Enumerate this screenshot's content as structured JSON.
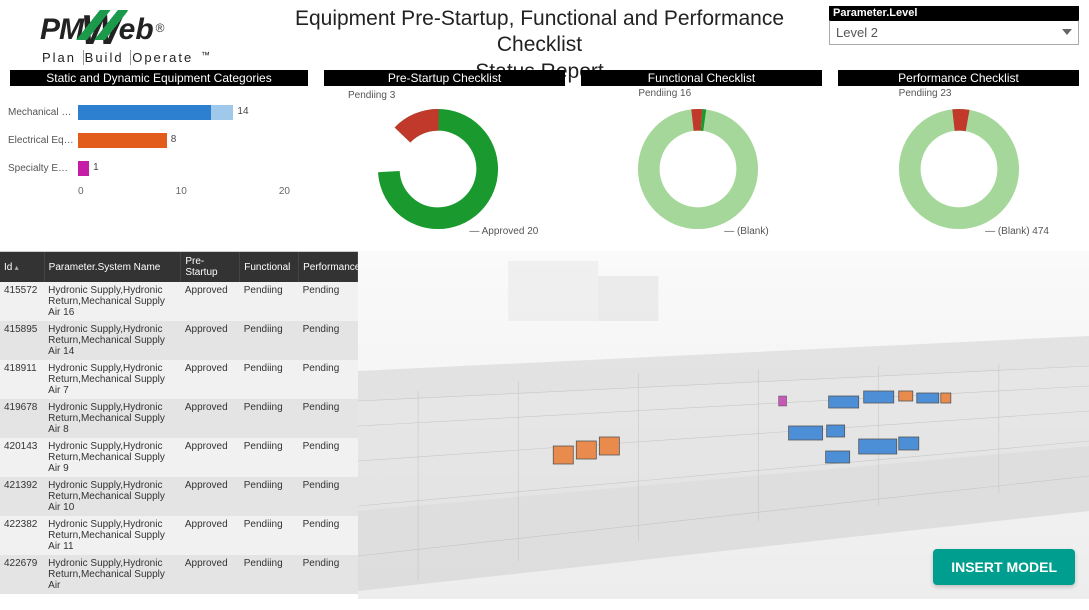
{
  "logo": {
    "pm": "PM",
    "eb": "eb",
    "reg": "®",
    "tagline": [
      "Plan",
      "Build",
      "Operate"
    ],
    "tm": "™"
  },
  "title": {
    "line1": "Equipment Pre-Startup, Functional and Performance Checklist",
    "line2": "Status Report"
  },
  "parameter": {
    "label": "Parameter.Level",
    "value": "Level 2"
  },
  "panels": {
    "categories": "Static and Dynamic Equipment Categories",
    "prestartup": "Pre-Startup Checklist",
    "functional": "Functional Checklist",
    "performance": "Performance Checklist"
  },
  "chart_data": [
    {
      "type": "bar",
      "title": "Static and Dynamic Equipment Categories",
      "categories": [
        "Mechanical …",
        "Electrical Eq…",
        "Specialty E…"
      ],
      "series": [
        {
          "name": "primary",
          "values": [
            12,
            8,
            1
          ],
          "colors": [
            "#2d7fd0",
            "#e25d1b",
            "#c51da6"
          ]
        },
        {
          "name": "remainder",
          "values": [
            2,
            0,
            0
          ],
          "colors": [
            "#a0c8ea",
            "",
            ""
          ]
        }
      ],
      "value_labels": [
        14,
        8,
        1
      ],
      "xlim": [
        0,
        20
      ],
      "xticks": [
        0,
        10,
        20
      ]
    },
    {
      "type": "pie",
      "title": "Pre-Startup Checklist",
      "slices": [
        {
          "label": "Approved",
          "value": 20,
          "color": "#1a9a2e"
        },
        {
          "label": "Pendiing",
          "value": 3,
          "color": "#c0392b"
        }
      ],
      "annotations": [
        "Pendiing 3",
        "Approved 20"
      ]
    },
    {
      "type": "pie",
      "title": "Functional Checklist",
      "slices": [
        {
          "label": "(Blank)",
          "value": 480,
          "color": "#a6d79a"
        },
        {
          "label": "Pendiing",
          "value": 16,
          "color": "#c0392b"
        },
        {
          "label": "Approved",
          "value": 4,
          "color": "#1a9a2e"
        }
      ],
      "annotations": [
        "Pendiing 16",
        "(Blank)"
      ]
    },
    {
      "type": "pie",
      "title": "Performance Checklist",
      "slices": [
        {
          "label": "(Blank)",
          "value": 474,
          "color": "#a6d79a"
        },
        {
          "label": "Pendiing",
          "value": 23,
          "color": "#c0392b"
        }
      ],
      "annotations": [
        "Pendiing 23",
        "(Blank) 474"
      ]
    }
  ],
  "barchart": {
    "rows": [
      {
        "label": "Mechanical …",
        "v1": 12,
        "v2": 2,
        "val": "14",
        "c1": "#2d7fd0",
        "c2": "#a0c8ea"
      },
      {
        "label": "Electrical Eq…",
        "v1": 8,
        "v2": 0,
        "val": "8",
        "c1": "#e25d1b",
        "c2": ""
      },
      {
        "label": "Specialty E…",
        "v1": 1,
        "v2": 0,
        "val": "1",
        "c1": "#c51da6",
        "c2": ""
      }
    ],
    "ticks": [
      "0",
      "10",
      "20"
    ],
    "max": 20
  },
  "donuts": {
    "prestartup": {
      "label_top": "Pendiing 3",
      "label_bottom": "Approved 20"
    },
    "functional": {
      "label_top": "Pendiing 16",
      "label_bottom": "(Blank)"
    },
    "performance": {
      "label_top": "Pendiing 23",
      "label_bottom": "(Blank) 474"
    }
  },
  "table": {
    "headers": {
      "id": "Id",
      "system": "Parameter.System Name",
      "pre": "Pre-Startup",
      "func": "Functional",
      "perf": "Performance"
    },
    "rows": [
      {
        "id": "415572",
        "system": "Hydronic Supply,Hydronic Return,Mechanical Supply Air 16",
        "pre": "Approved",
        "func": "Pendiing",
        "perf": "Pending"
      },
      {
        "id": "415895",
        "system": "Hydronic Supply,Hydronic Return,Mechanical Supply Air 14",
        "pre": "Approved",
        "func": "Pendiing",
        "perf": "Pending"
      },
      {
        "id": "418911",
        "system": "Hydronic Supply,Hydronic Return,Mechanical Supply Air 7",
        "pre": "Approved",
        "func": "Pendiing",
        "perf": "Pending"
      },
      {
        "id": "419678",
        "system": "Hydronic Supply,Hydronic Return,Mechanical Supply Air 8",
        "pre": "Approved",
        "func": "Pendiing",
        "perf": "Pending"
      },
      {
        "id": "420143",
        "system": "Hydronic Supply,Hydronic Return,Mechanical Supply Air 9",
        "pre": "Approved",
        "func": "Pendiing",
        "perf": "Pending"
      },
      {
        "id": "421392",
        "system": "Hydronic Supply,Hydronic Return,Mechanical Supply Air 10",
        "pre": "Approved",
        "func": "Pendiing",
        "perf": "Pending"
      },
      {
        "id": "422382",
        "system": "Hydronic Supply,Hydronic Return,Mechanical Supply Air 11",
        "pre": "Approved",
        "func": "Pendiing",
        "perf": "Pending"
      },
      {
        "id": "422679",
        "system": "Hydronic Supply,Hydronic Return,Mechanical Supply Air",
        "pre": "Approved",
        "func": "Pendiing",
        "perf": "Pending"
      }
    ]
  },
  "button": {
    "insert_model": "INSERT MODEL"
  }
}
